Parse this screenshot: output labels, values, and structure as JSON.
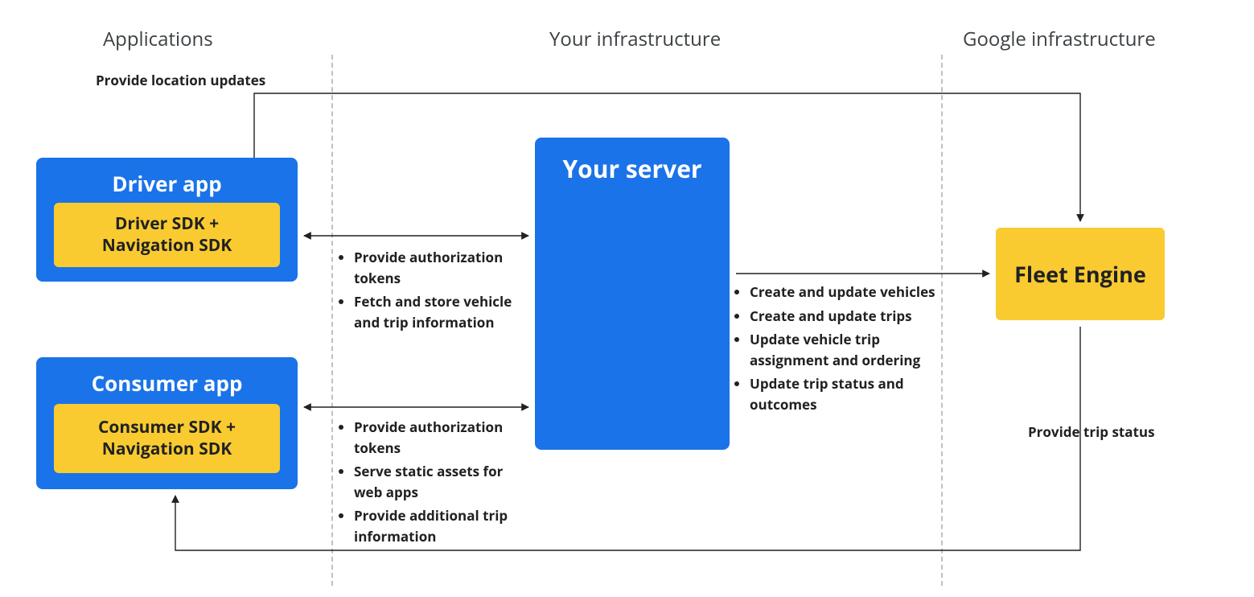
{
  "sections": {
    "apps": "Applications",
    "infra": "Your infrastructure",
    "google": "Google infrastructure"
  },
  "boxes": {
    "driver_app": {
      "title": "Driver app",
      "sdk": "Driver SDK +\nNavigation SDK"
    },
    "consumer_app": {
      "title": "Consumer app",
      "sdk": "Consumer SDK +\nNavigation SDK"
    },
    "server": {
      "title": "Your server"
    },
    "fleet_engine": {
      "title": "Fleet Engine"
    }
  },
  "notes": {
    "driver_server": [
      "Provide authorization tokens",
      "Fetch and store vehicle and trip information"
    ],
    "consumer_server": [
      "Provide authorization tokens",
      "Serve static assets for web apps",
      "Provide additional trip information"
    ],
    "server_engine": [
      "Create and update vehicles",
      "Create and update trips",
      "Update vehicle trip assignment and ordering",
      "Update trip status and outcomes"
    ]
  },
  "edge_labels": {
    "top": "Provide location updates",
    "right": "Provide trip status"
  },
  "colors": {
    "blue": "#1a73e8",
    "yellow": "#f9cb30",
    "text_dark": "#202124",
    "header_gray": "#3c4043"
  }
}
